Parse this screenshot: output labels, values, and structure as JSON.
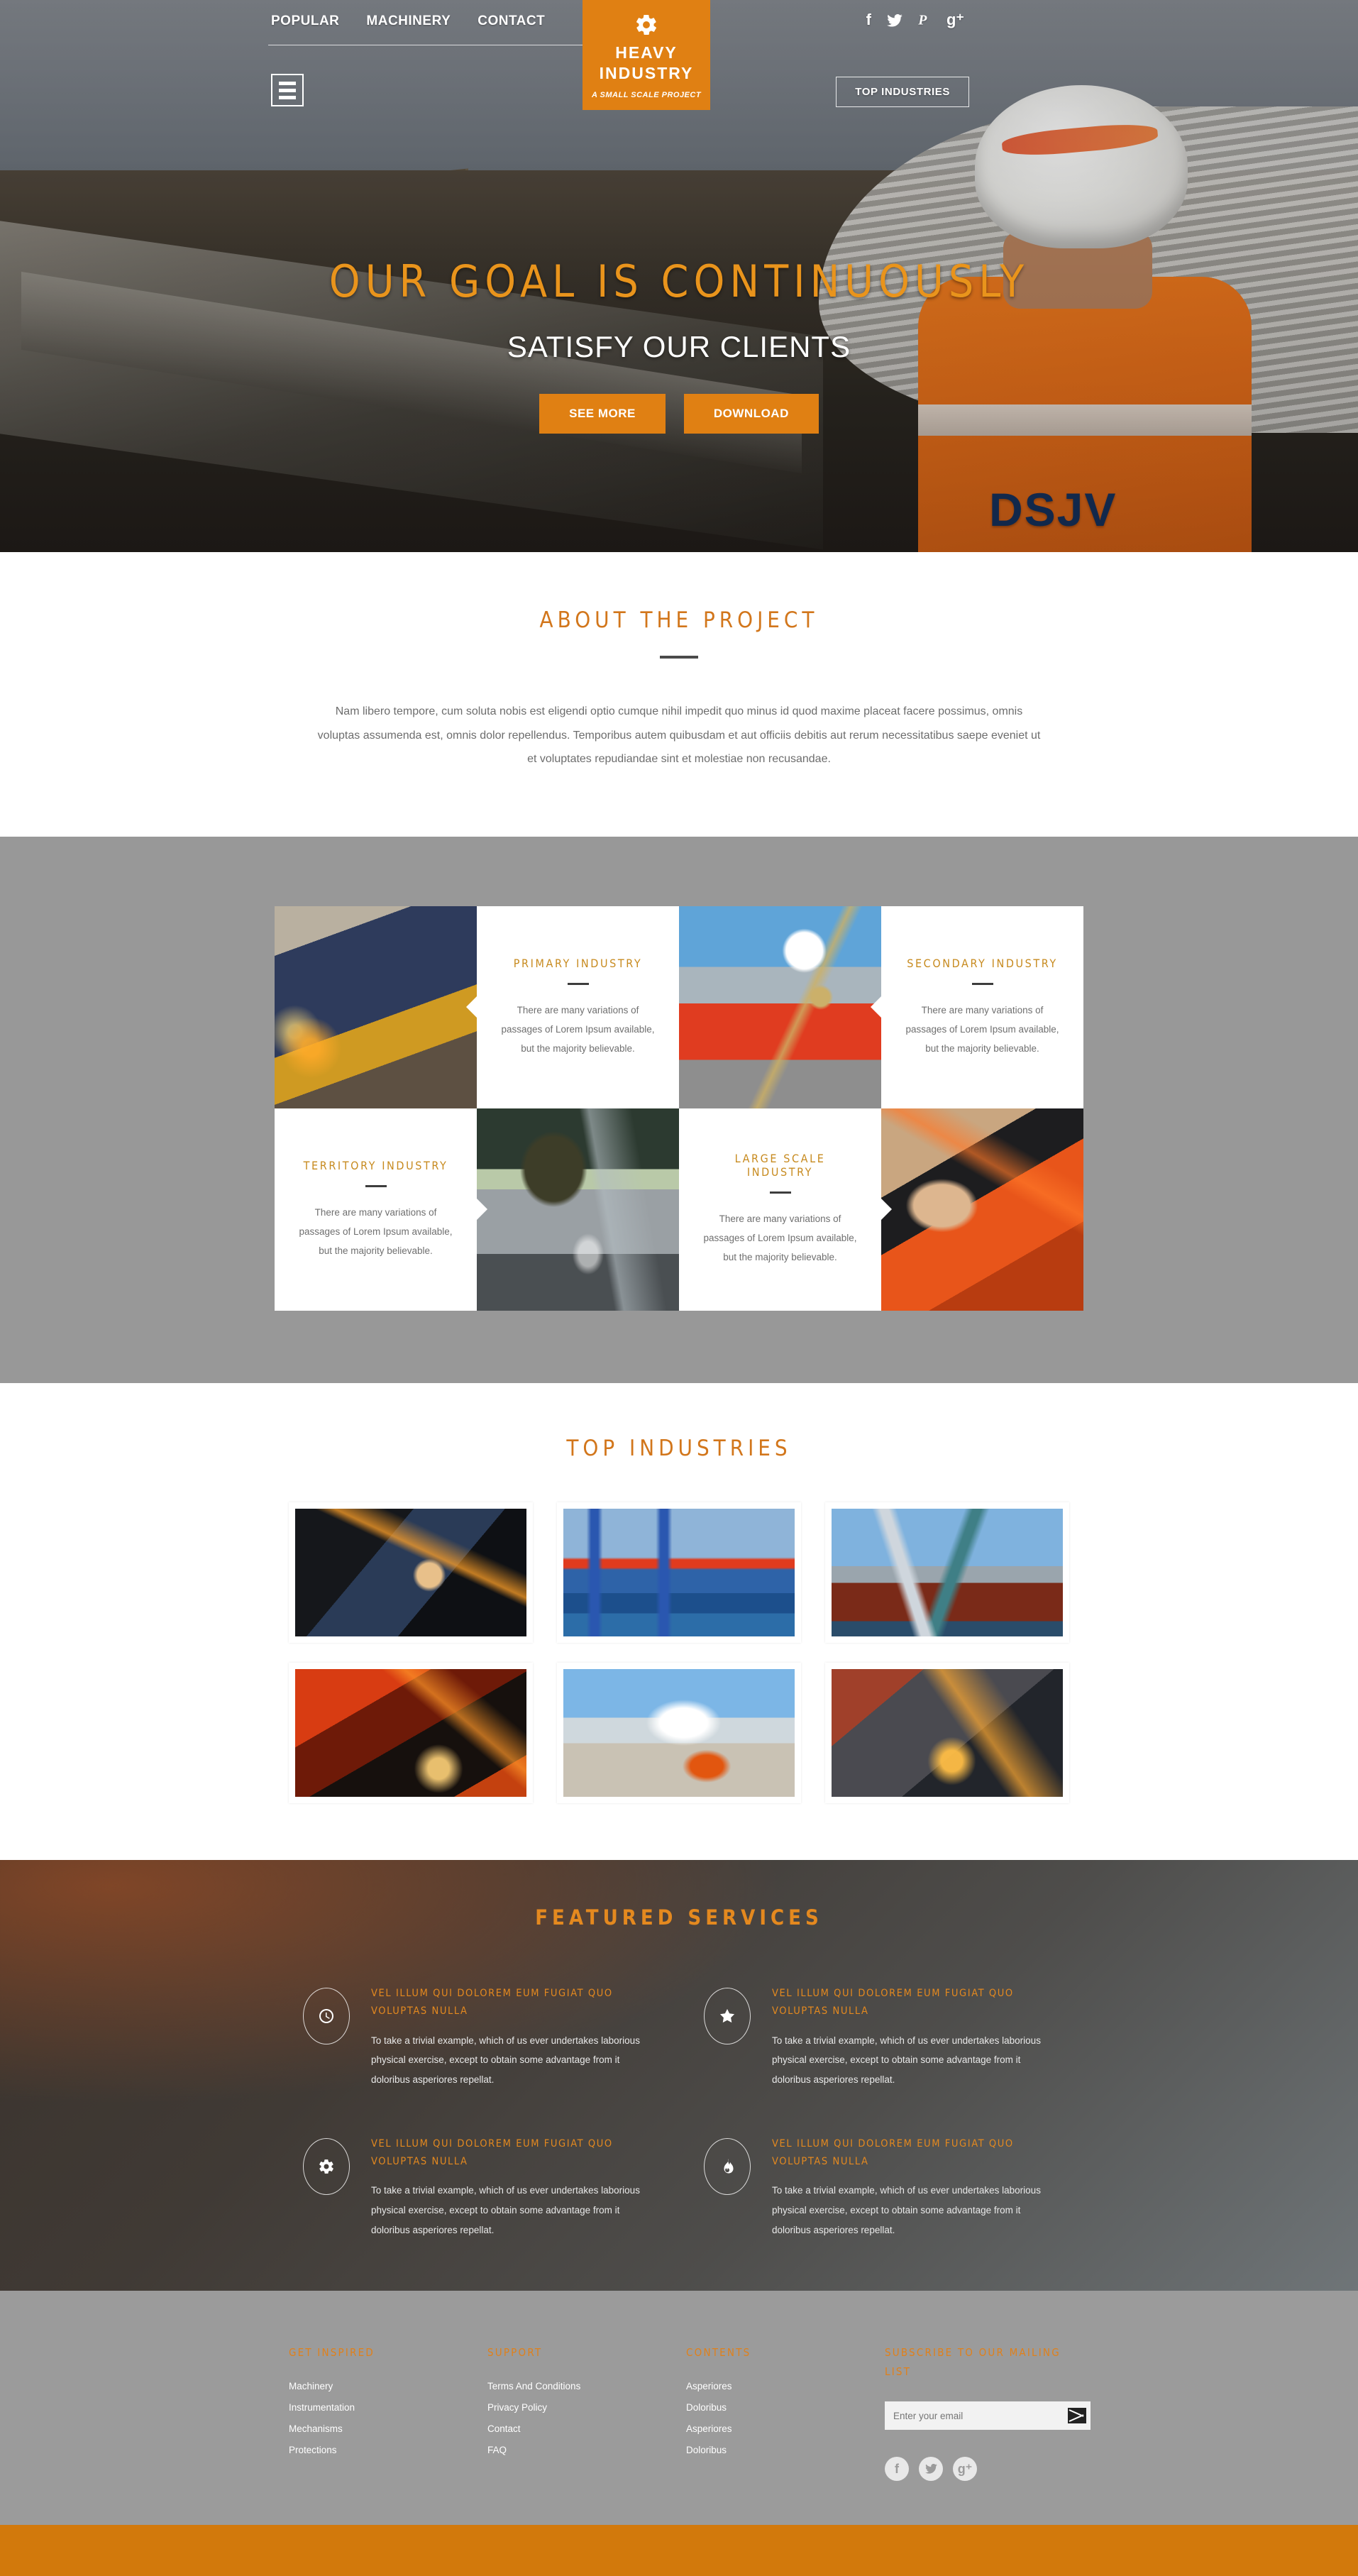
{
  "header": {
    "nav": [
      {
        "label": "POPULAR"
      },
      {
        "label": "MACHINERY"
      },
      {
        "label": "CONTACT"
      }
    ],
    "social": [
      {
        "name": "facebook-icon",
        "glyph": "f"
      },
      {
        "name": "twitter-icon",
        "glyph": "ᵗ"
      },
      {
        "name": "pinterest-icon",
        "glyph": "P"
      },
      {
        "name": "google-plus-icon",
        "glyph": "g⁺"
      }
    ],
    "logo": {
      "icon": "gear-icon",
      "line1": "HEAVY",
      "line2": "INDUSTRY",
      "tagline": "A SMALL SCALE PROJECT",
      "color": "#e08013"
    },
    "menu_button": "hamburger-icon",
    "top_industries_button": "TOP INDUSTRIES"
  },
  "hero": {
    "headline": "OUR GOAL IS CONTINUOUSLY",
    "subheadline": "SATISFY OUR CLIENTS",
    "headline_color": "#e9941c",
    "buttons": [
      {
        "label": "SEE MORE"
      },
      {
        "label": "DOWNLOAD"
      }
    ],
    "worker_text": "DSJV"
  },
  "about": {
    "title": "ABOUT THE PROJECT",
    "title_color": "#d2761b",
    "body": "Nam libero tempore, cum soluta nobis est eligendi optio cumque nihil impedit quo minus id quod maxime placeat facere possimus, omnis voluptas assumenda est, omnis dolor repellendus. Temporibus autem quibusdam et aut officiis debitis aut rerum necessitatibus saepe eveniet ut et voluptates repudiandae sint et molestiae non recusandae."
  },
  "industries": {
    "background_color": "#989898",
    "cards": [
      {
        "title": "PRIMARY INDUSTRY",
        "body": "There are many variations of passages of Lorem Ipsum available, but the majority believable.",
        "image": "welder-with-sparks-photo"
      },
      {
        "title": "SECONDARY INDUSTRY",
        "body": "There are many variations of passages of Lorem Ipsum available, but the majority believable.",
        "image": "worker-with-chain-photo"
      },
      {
        "title": "TERRITORY INDUSTRY",
        "body": "There are many variations of passages of Lorem Ipsum available, but the majority believable.",
        "image": "pipe-welding-photo"
      },
      {
        "title": "LARGE SCALE INDUSTRY",
        "body": "There are many variations of passages of Lorem Ipsum available, but the majority believable.",
        "image": "orange-clamp-tool-photo"
      }
    ]
  },
  "top_industries": {
    "title": "TOP INDUSTRIES",
    "title_color": "#d2761b",
    "images": [
      {
        "name": "grinding-worker-photo"
      },
      {
        "name": "port-cranes-photo"
      },
      {
        "name": "shipyard-crane-photo"
      },
      {
        "name": "red-furnace-welding-photo"
      },
      {
        "name": "concrete-saw-photo"
      },
      {
        "name": "sparks-cutting-photo"
      }
    ]
  },
  "featured_services": {
    "title": "FEATURED SERVICES",
    "title_color": "#e4891f",
    "items": [
      {
        "icon": "clock-icon",
        "heading": "VEL ILLUM QUI DOLOREM EUM FUGIAT QUO VOLUPTAS NULLA",
        "body": "To take a trivial example, which of us ever undertakes laborious physical exercise, except to obtain some advantage from it doloribus asperiores repellat."
      },
      {
        "icon": "star-icon",
        "heading": "VEL ILLUM QUI DOLOREM EUM FUGIAT QUO VOLUPTAS NULLA",
        "body": "To take a trivial example, which of us ever undertakes laborious physical exercise, except to obtain some advantage from it doloribus asperiores repellat."
      },
      {
        "icon": "gear-icon",
        "heading": "VEL ILLUM QUI DOLOREM EUM FUGIAT QUO VOLUPTAS NULLA",
        "body": "To take a trivial example, which of us ever undertakes laborious physical exercise, except to obtain some advantage from it doloribus asperiores repellat."
      },
      {
        "icon": "flame-icon",
        "heading": "VEL ILLUM QUI DOLOREM EUM FUGIAT QUO VOLUPTAS NULLA",
        "body": "To take a trivial example, which of us ever undertakes laborious physical exercise, except to obtain some advantage from it doloribus asperiores repellat."
      }
    ]
  },
  "footer": {
    "background_color": "#9b9b9b",
    "accent_color": "#e0801a",
    "columns": [
      {
        "heading": "GET INSPIRED",
        "links": [
          "Machinery",
          "Instrumentation",
          "Mechanisms",
          "Protections"
        ]
      },
      {
        "heading": "SUPPORT",
        "links": [
          "Terms And Conditions",
          "Privacy Policy",
          "Contact",
          "FAQ"
        ]
      },
      {
        "heading": "CONTENTS",
        "links": [
          "Asperiores",
          "Doloribus",
          "Asperiores",
          "Doloribus"
        ]
      }
    ],
    "subscribe": {
      "heading": "SUBSCRIBE TO OUR MAILING LIST",
      "placeholder": "Enter your email",
      "value": "",
      "submit_icon": "envelope-icon"
    },
    "social": [
      {
        "name": "facebook-icon",
        "glyph": "f"
      },
      {
        "name": "twitter-icon",
        "glyph": "ᵗ"
      },
      {
        "name": "google-plus-icon",
        "glyph": "g⁺"
      }
    ],
    "bottom_bar_color": "#d2790c"
  }
}
